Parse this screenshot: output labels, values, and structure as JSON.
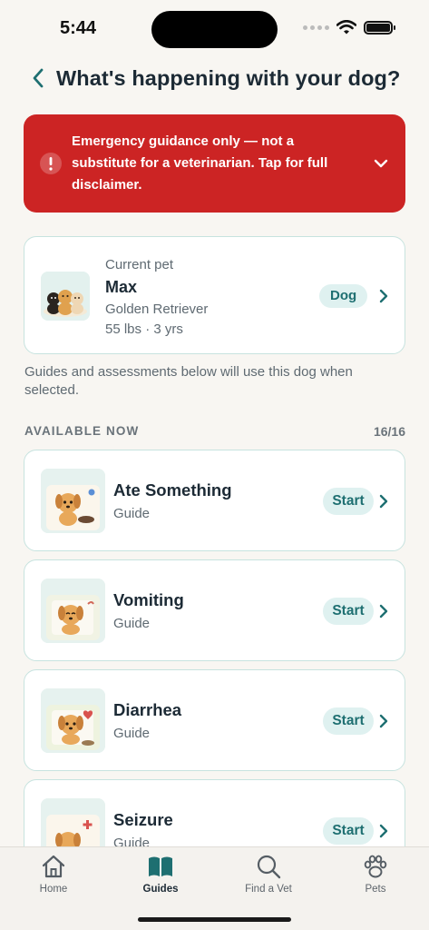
{
  "status_bar": {
    "time": "5:44"
  },
  "header": {
    "title": "What's happening with your dog?"
  },
  "banner": {
    "text": "Emergency guidance only — not a substitute for a veterinarian. Tap for full disclaimer."
  },
  "pet": {
    "eyebrow": "Current pet",
    "name": "Max",
    "breed": "Golden Retriever",
    "meta": "55 lbs · 3 yrs",
    "species": "Dog"
  },
  "helper_text": "Guides and assessments below will use this dog when selected.",
  "section": {
    "title": "AVAILABLE NOW",
    "count": "16/16"
  },
  "guides": [
    {
      "title": "Ate Something",
      "subtitle": "Guide",
      "action": "Start"
    },
    {
      "title": "Vomiting",
      "subtitle": "Guide",
      "action": "Start"
    },
    {
      "title": "Diarrhea",
      "subtitle": "Guide",
      "action": "Start"
    },
    {
      "title": "Seizure",
      "subtitle": "Guide",
      "action": "Start"
    }
  ],
  "tabs": [
    {
      "label": "Home",
      "icon": "home-icon"
    },
    {
      "label": "Guides",
      "icon": "book-icon",
      "active": true
    },
    {
      "label": "Find a Vet",
      "icon": "search-icon"
    },
    {
      "label": "Pets",
      "icon": "paw-icon"
    }
  ],
  "colors": {
    "accent": "#1e6f71",
    "danger": "#cc2424",
    "card_border": "#c7e3df",
    "badge_bg": "#dff1f0"
  }
}
